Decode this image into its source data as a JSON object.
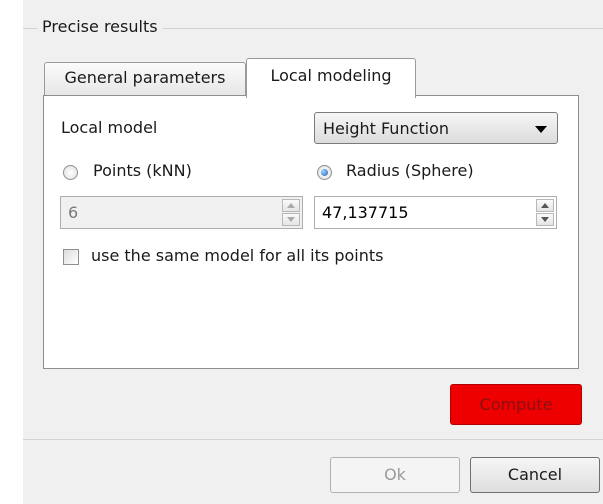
{
  "group": {
    "title": "Precise results"
  },
  "tabs": [
    {
      "label": "General parameters",
      "active": false
    },
    {
      "label": "Local modeling",
      "active": true
    }
  ],
  "local_model": {
    "label": "Local model",
    "selected": "Height Function"
  },
  "neighborhood": {
    "points_label": "Points (kNN)",
    "points_checked": false,
    "radius_label": "Radius (Sphere)",
    "radius_checked": true,
    "points_value": "6",
    "radius_value": "47,137715"
  },
  "same_model": {
    "label": "use the same model for all its points",
    "checked": false
  },
  "buttons": {
    "compute": "Compute",
    "ok": "Ok",
    "cancel": "Cancel"
  },
  "colors": {
    "compute_bg": "#ee0000",
    "dialog_bg": "#f0f0f0"
  }
}
